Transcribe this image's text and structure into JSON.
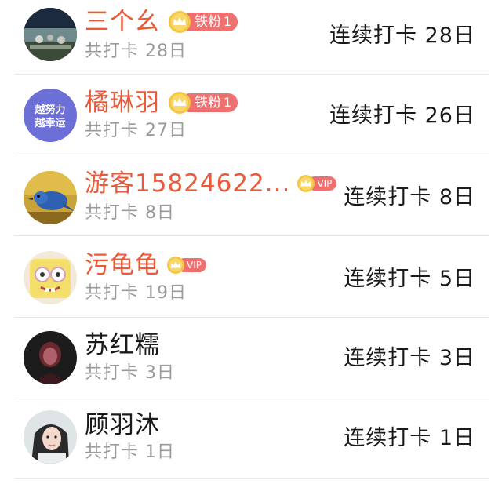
{
  "users": [
    {
      "name": "三个幺",
      "name_color": "red",
      "badge_type": "fan",
      "badge_label": "铁粉",
      "badge_level": "1",
      "total_checkins": "共打卡 28日",
      "streak": "连续打卡 28日"
    },
    {
      "name": "橘琳羽",
      "name_color": "red",
      "badge_type": "fan",
      "badge_label": "铁粉",
      "badge_level": "1",
      "total_checkins": "共打卡 27日",
      "streak": "连续打卡 26日",
      "avatar_text_line1": "越努力",
      "avatar_text_line2": "越幸运"
    },
    {
      "name": "游客15824622...",
      "name_color": "red",
      "badge_type": "vip",
      "badge_label": "VIP",
      "total_checkins": "共打卡 8日",
      "streak": "连续打卡 8日"
    },
    {
      "name": "污龟龟",
      "name_color": "red",
      "badge_type": "vip",
      "badge_label": "VIP",
      "total_checkins": "共打卡 19日",
      "streak": "连续打卡 5日"
    },
    {
      "name": "苏红糯",
      "name_color": "black",
      "badge_type": "none",
      "total_checkins": "共打卡 3日",
      "streak": "连续打卡 3日"
    },
    {
      "name": "顾羽沐",
      "name_color": "black",
      "badge_type": "none",
      "total_checkins": "共打卡 1日",
      "streak": "连续打卡 1日"
    }
  ],
  "colors": {
    "name_highlight": "#ea5a3a",
    "badge_bg": "#f07070",
    "crown_gold": "#f5c542",
    "secondary_text": "#9a9a9a",
    "divider": "#e6e6e6"
  },
  "icons": {
    "crown": "crown-icon"
  }
}
